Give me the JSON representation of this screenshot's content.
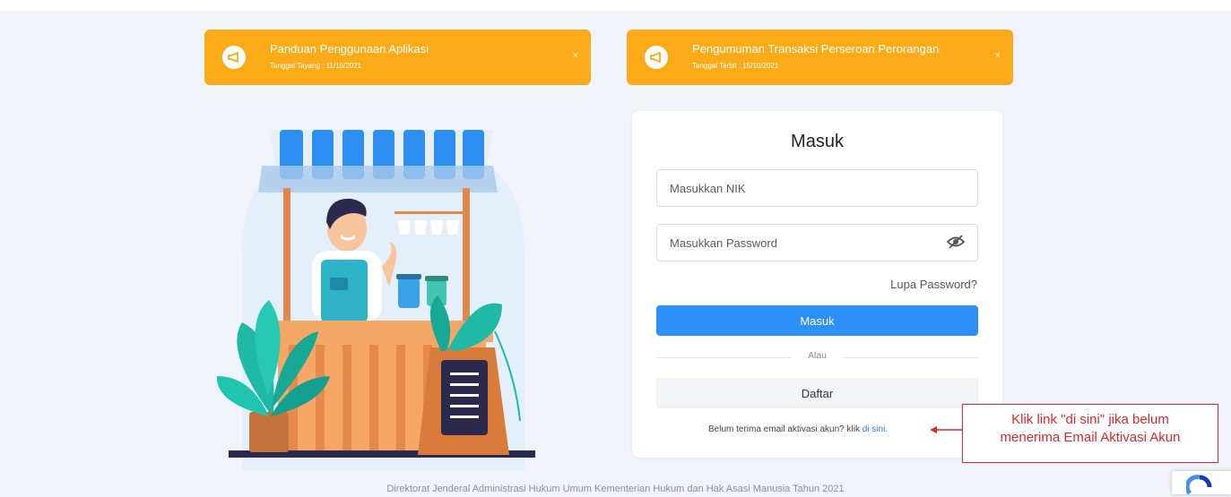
{
  "banners": [
    {
      "title": "Panduan Penggunaan Aplikasi",
      "date": "Tanggal Tayang : 11/10/2021",
      "icon": "megaphone-icon",
      "close": "×"
    },
    {
      "title": "Pengumuman Transaksi Perseroan Perorangan",
      "date": "Tanggal Terbit : 15/10/2021",
      "icon": "megaphone-icon",
      "close": "×"
    }
  ],
  "login": {
    "title": "Masuk",
    "nik_placeholder": "Masukkan NIK",
    "password_placeholder": "Masukkan Password",
    "forgot_label": "Lupa Password?",
    "submit_label": "Masuk",
    "divider_label": "Atau",
    "register_label": "Daftar",
    "activation_text": "Belum terima email aktivasi akun? klik",
    "activation_link": "di sini."
  },
  "annotation": {
    "line1": "Klik link \"di sini\" jika belum",
    "line2": "menerima Email Aktivasi Akun"
  },
  "footer": "Direktorat Jenderal Administrasi Hukum Umum Kementerian Hukum dan Hak Asasi Manusia Tahun 2021",
  "colors": {
    "banner": "#fbab18",
    "primary": "#2e90f6",
    "annotation": "#e4262b",
    "background": "#f0f3f9"
  }
}
